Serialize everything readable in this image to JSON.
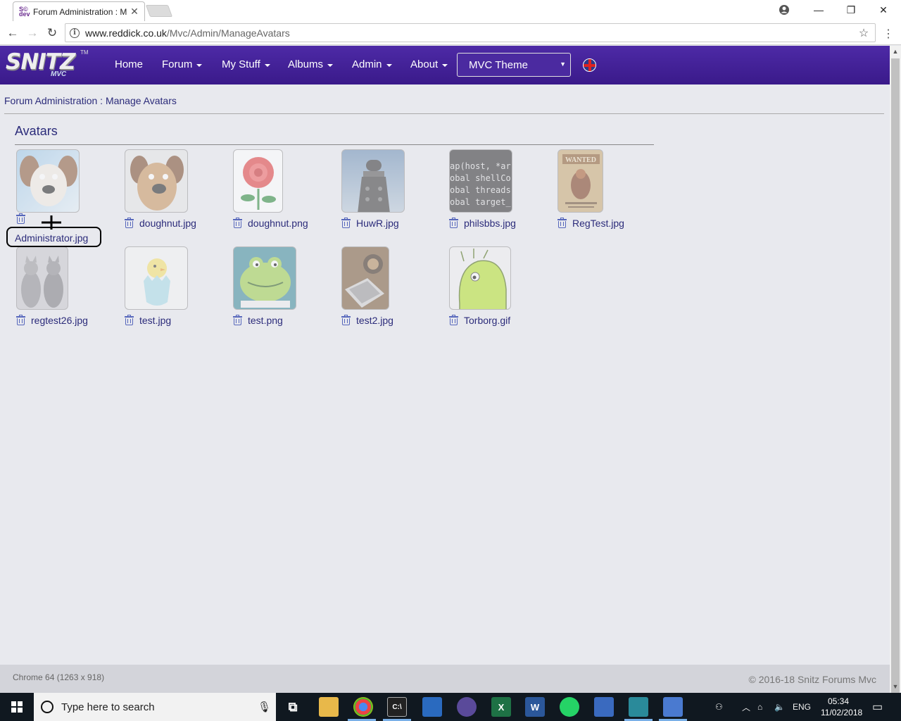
{
  "browser": {
    "tab_title": "Forum Administration : M",
    "url_host": "www.reddick.co.uk",
    "url_path": "/Mvc/Admin/ManageAvatars"
  },
  "site": {
    "logo_text": "SNITZ",
    "logo_sub": "MVC",
    "logo_tm": "TM",
    "nav": [
      {
        "label": "Home",
        "dropdown": false
      },
      {
        "label": "Forum",
        "dropdown": true
      },
      {
        "label": "My Stuff",
        "dropdown": true
      },
      {
        "label": "Albums",
        "dropdown": true
      },
      {
        "label": "Admin",
        "dropdown": true
      },
      {
        "label": "About",
        "dropdown": true
      }
    ],
    "theme_select": "MVC Theme"
  },
  "page": {
    "breadcrumb": "Forum Administration : Manage Avatars",
    "section_title": "Avatars",
    "avatars": [
      {
        "filename": "Administrator.jpg",
        "image": "dog-wallace-gromit"
      },
      {
        "filename": "doughnut.jpg",
        "image": "dog-gromit-plush"
      },
      {
        "filename": "doughnut.png",
        "image": "red-rose"
      },
      {
        "filename": "HuwR.jpg",
        "image": "dalek"
      },
      {
        "filename": "philsbbs.jpg",
        "image": "code-text"
      },
      {
        "filename": "RegTest.jpg",
        "image": "wanted-poster"
      },
      {
        "filename": "regtest26.jpg",
        "image": "two-cats"
      },
      {
        "filename": "test.jpg",
        "image": "chick-in-egg"
      },
      {
        "filename": "test.png",
        "image": "green-frog"
      },
      {
        "filename": "test2.jpg",
        "image": "desk-keyboard"
      },
      {
        "filename": "Torborg.gif",
        "image": "green-creature"
      }
    ],
    "code_lines": [
      "ap(host, *ar",
      "obal shellCo",
      "obal threads",
      "obal target_"
    ]
  },
  "footer": {
    "left": "Chrome 64 (1263 x 918)",
    "right": "© 2016-18 Snitz Forums Mvc"
  },
  "taskbar": {
    "search_placeholder": "Type here to search",
    "language": "ENG",
    "time": "05:34",
    "date": "11/02/2018"
  }
}
